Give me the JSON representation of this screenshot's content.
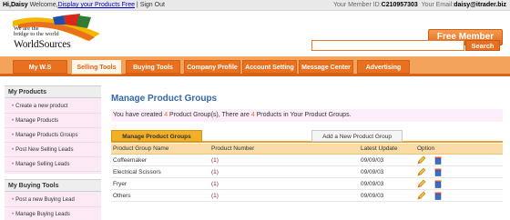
{
  "topbar": {
    "greeting": "Hi,Daisy",
    "welcome": " Welcome,",
    "display_link": "Display your Products Free",
    "sign_out": " | Sign Out",
    "member_id_label": "Your Member ID:",
    "member_id": "C210957303",
    "email_label": "Your Email:",
    "email": "daisy@itrader.biz"
  },
  "logo": {
    "tagline_1": "We are the",
    "tagline_2": "bridge to the world",
    "brand": "WorldSources"
  },
  "header": {
    "free_member": "Free Member",
    "search_placeholder": "",
    "search_button": "Search"
  },
  "nav": {
    "tabs": [
      {
        "label": "My W.S"
      },
      {
        "label": "Selling Tools",
        "active": true
      },
      {
        "label": "Buying Tools"
      },
      {
        "label": "Company Profile"
      },
      {
        "label": "Account Setting"
      },
      {
        "label": "Message Center"
      },
      {
        "label": "Advertising"
      }
    ]
  },
  "sidebar": {
    "sections": [
      {
        "title": "My Products",
        "items": [
          "Create a new product",
          "Manage Products",
          "Manage Products Groups",
          "Post New Selling Leads",
          "Manage Selling Leads"
        ]
      },
      {
        "title": "My Buying Tools",
        "items": [
          "Post a new Buying Lead",
          "Manage Buying Leads"
        ]
      }
    ]
  },
  "main": {
    "title": "Manage Product Groups",
    "summary_1": "You have created ",
    "summary_groups": "4",
    "summary_2": " Product Group(s), There are ",
    "summary_products": "4",
    "summary_3": " Products in Your Product Groups.",
    "tab_active": "Manage Product Groups",
    "tab_add": "Add a New Product Group",
    "columns": [
      "Product Group Name",
      "Product Number",
      "Latest Update",
      "Option"
    ],
    "rows": [
      {
        "name": "Coffeemaker",
        "number": "(1)",
        "date": "09/09/03"
      },
      {
        "name": "Electrical Scissors",
        "number": "(1)",
        "date": "09/09/03"
      },
      {
        "name": "Fryer",
        "number": "(1)",
        "date": "09/09/03"
      },
      {
        "name": "Others",
        "number": "(1)",
        "date": "09/09/03"
      }
    ]
  },
  "colors": {
    "accent": "#e8701f",
    "nav_bg": "#f4a35a",
    "title_blue": "#3366aa",
    "sidebar_pink": "#fbe9f6"
  }
}
